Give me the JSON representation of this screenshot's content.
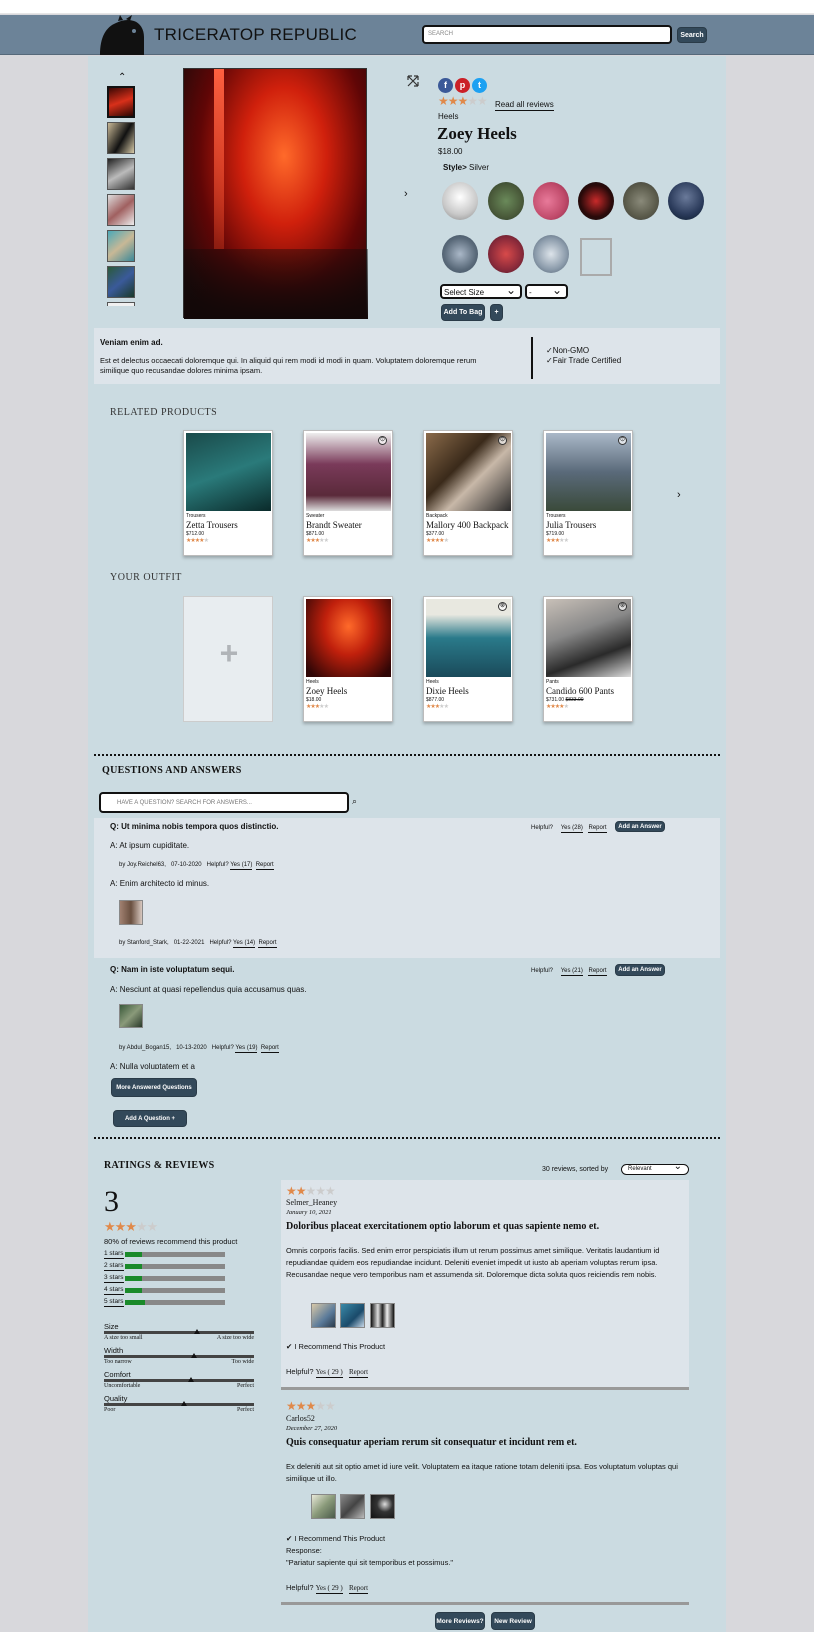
{
  "app": {
    "brand": "TRICERATOP REPUBLIC",
    "search_placeholder": "SEARCH",
    "search_button": "Search"
  },
  "product": {
    "category": "Heels",
    "name": "Zoey Heels",
    "price": "$18.00",
    "rating": 3,
    "read_reviews": "Read all reviews",
    "style_label": "Style>",
    "style_value": "Silver",
    "size_select": "Select Size",
    "qty_select": "-",
    "add_to_bag": "Add To Bag",
    "plus": "+",
    "social": [
      "facebook",
      "pinterest",
      "twitter"
    ],
    "slogan": "Veniam enim ad.",
    "description": "Est et delectus occaecati doloremque qui. In aliquid qui rem modi id modi in quam. Voluptatem doloremque rerum similique quo recusandae dolores minima ipsam.",
    "features": [
      "✓Non-GMO",
      "✓Fair Trade Certified"
    ],
    "colors": {
      "accent": "#33495a",
      "star": "#e0894a",
      "header": "#6c8398",
      "page": "#cbdbe1"
    }
  },
  "related": {
    "heading": "RELATED PRODUCTS",
    "items": [
      {
        "category": "Trousers",
        "name": "Zetta Trousers",
        "price": "$712.00",
        "rating": 4
      },
      {
        "category": "Sweater",
        "name": "Brandt Sweater",
        "price": "$871.00",
        "rating": 3
      },
      {
        "category": "Backpack",
        "name": "Mallory 400 Backpack",
        "price": "$377.00",
        "rating": 3.5
      },
      {
        "category": "Trousers",
        "name": "Julia Trousers",
        "price": "$719.00",
        "rating": 3
      }
    ]
  },
  "outfit": {
    "heading": "YOUR OUTFIT",
    "add_symbol": "+",
    "items": [
      {
        "category": "Heels",
        "name": "Zoey Heels",
        "price": "$18.00",
        "rating": 3
      },
      {
        "category": "Heels",
        "name": "Dixie Heels",
        "price": "$877.00",
        "rating": 3
      },
      {
        "category": "Pants",
        "name": "Candido 600 Pants",
        "price": "$731.00",
        "old_price": "$833.00",
        "rating": 3.5
      }
    ]
  },
  "qa": {
    "heading": "QUESTIONS AND ANSWERS",
    "search_placeholder": "HAVE A QUESTION? SEARCH FOR ANSWERS...",
    "helpful": "Helpful?",
    "report": "Report",
    "add_answer": "Add an Answer",
    "questions": [
      {
        "q": "Q: Ut minima nobis tempora quos distinctio.",
        "yes": "Yes (28)",
        "answers": [
          {
            "text": "A: At ipsum cupiditate.",
            "by": "by Joy.Reichel63,",
            "date": "07-10-2020",
            "yes": "Yes (17)"
          },
          {
            "text": "A: Enim architecto id minus.",
            "by": "by Stanford_Stark,",
            "date": "01-22-2021",
            "yes": "Yes (14)"
          }
        ]
      },
      {
        "q": "Q: Nam in iste voluptatum sequi.",
        "yes": "Yes (21)",
        "answers": [
          {
            "text": "A: Nesciunt at quasi repellendus quia accusamus quas.",
            "by": "by Abdul_Bogan15,",
            "date": "10-13-2020",
            "yes": "Yes (19)"
          },
          {
            "text": "A: Nulla voluptatem et a"
          }
        ]
      }
    ],
    "more_button": "More Answered Questions",
    "add_question": "Add A Question +"
  },
  "ratings": {
    "heading": "RATINGS & REVIEWS",
    "average": "3",
    "average_stars": 3,
    "recommend": "80% of reviews recommend this product",
    "breakdown": [
      {
        "label": "1 stars",
        "fraction": 0.17
      },
      {
        "label": "2 stars",
        "fraction": 0.17
      },
      {
        "label": "3 stars",
        "fraction": 0.17
      },
      {
        "label": "4 stars",
        "fraction": 0.17
      },
      {
        "label": "5 stars",
        "fraction": 0.2
      }
    ],
    "characteristics": [
      {
        "name": "Size",
        "low": "A size too small",
        "high": "A size too wide",
        "value": 0.62
      },
      {
        "name": "Width",
        "low": "Too narrow",
        "high": "Too wide",
        "value": 0.6
      },
      {
        "name": "Comfort",
        "low": "Uncomfortable",
        "high": "Perfect",
        "value": 0.58
      },
      {
        "name": "Quality",
        "low": "Poor",
        "high": "Perfect",
        "value": 0.53
      }
    ],
    "summary": "30 reviews, sorted by",
    "sort": "Relevant",
    "reviews": [
      {
        "rating": 2,
        "user": "Selmer_Heaney",
        "date": "January 10, 2021",
        "title": "Doloribus placeat exercitationem optio laborum et quas sapiente nemo et.",
        "body": "Omnis corporis facilis. Sed enim error perspiciatis illum ut rerum possimus amet similique. Veritatis laudantium id repudiandae quidem eos repudiandae incidunt. Deleniti eveniet impedit ut iusto ab aperiam voluptas rerum ipsa. Recusandae neque vero temporibus nam et assumenda sit. Doloremque dicta soluta quos reiciendis rem nobis.",
        "recommend": "I Recommend This Product",
        "helpful": "Helpful?",
        "yes": "Yes ( 29 )",
        "report": "Report"
      },
      {
        "rating": 3,
        "user": "Carlos52",
        "date": "December 27, 2020",
        "title": "Quis consequatur aperiam rerum sit consequatur et incidunt rem et.",
        "body": "Ex deleniti aut sit optio amet id iure velit. Voluptatem ea itaque ratione totam deleniti ipsa. Eos voluptatum voluptas qui similique ut illo.",
        "recommend": "I Recommend This Product",
        "response_label": "Response:",
        "response": "\"Pariatur sapiente qui sit temporibus et possimus.\"",
        "helpful": "Helpful?",
        "yes": "Yes ( 29 )",
        "report": "Report"
      }
    ],
    "more_reviews": "More Reviews?",
    "new_review": "New Review"
  }
}
